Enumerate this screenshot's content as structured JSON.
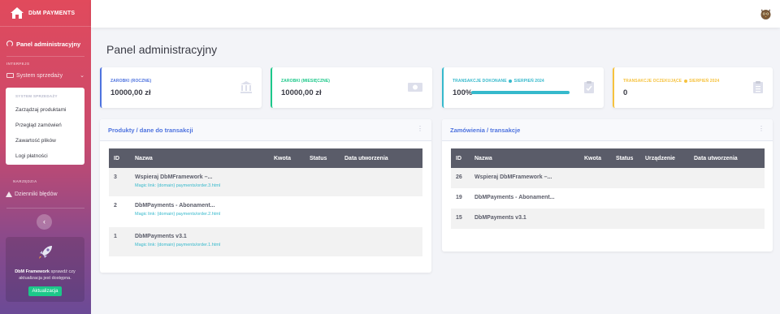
{
  "sidebar": {
    "brand": "DbM PAYMENTS",
    "dashboard_label": "Panel administracyjny",
    "heading_interface": "INTERFEJS",
    "system_label": "System sprzedaży",
    "submenu_heading": "SYSTEM SPRZEDAŻY",
    "submenu_items": [
      "Zarządzaj produktami",
      "Przegląd zamówień",
      "Zawartość plików",
      "Logi płatności"
    ],
    "heading_tools": "NARZĘDZIA",
    "logs_label": "Dzienniki błędów",
    "toggle_icon": "‹",
    "promo_brand": "DbM Framework",
    "promo_text": "sprawdź czy aktualizacja jest dostępna.",
    "promo_button": "Aktualizacja"
  },
  "page_title": "Panel administracyjny",
  "stats": [
    {
      "label": "ZAROBKI (ROCZNE)",
      "value": "10000,00 zł",
      "color": "#4e73df",
      "icon": "bank-icon"
    },
    {
      "label": "ZAROBKI (MIESIĘCZNE)",
      "value": "10000,00 zł",
      "color": "#1cc88a",
      "icon": "money-icon"
    },
    {
      "label_a": "TRANSAKCJE DOKONANE",
      "label_b": "SIERPIEŃ 2024",
      "value": "100%",
      "progress": 1.0,
      "color": "#36b9cc",
      "icon": "clipboard-check-icon"
    },
    {
      "label_a": "TRANSAKCJE OCZEKUJĄCE",
      "label_b": "SIERPIEŃ 2024",
      "value": "0",
      "color": "#f6c23e",
      "icon": "clipboard-list-icon"
    }
  ],
  "products": {
    "title": "Produkty / dane do transakcji",
    "columns": [
      "ID",
      "Nazwa",
      "Kwota",
      "Status",
      "Data utworzenia"
    ],
    "rows": [
      {
        "id": "3",
        "name": "Wspieraj DbMFramework –...",
        "link": "Magic link: {domain} payments/order.3.html"
      },
      {
        "id": "2",
        "name": "DbMPayments - Abonament...",
        "link": "Magic link: {domain} payments/order.2.html"
      },
      {
        "id": "1",
        "name": "DbMPayments v3.1",
        "link": "Magic link: {domain} payments/order.1.html"
      }
    ]
  },
  "orders": {
    "title": "Zamówienia / transakcje",
    "columns": [
      "ID",
      "Nazwa",
      "Kwota",
      "Status",
      "Urządzenie",
      "Data utworzenia"
    ],
    "rows": [
      {
        "id": "26",
        "name": "Wspieraj DbMFramework –..."
      },
      {
        "id": "19",
        "name": "DbMPayments - Abonament..."
      },
      {
        "id": "15",
        "name": "DbMPayments v3.1"
      }
    ]
  },
  "menu_dots": "⋮"
}
